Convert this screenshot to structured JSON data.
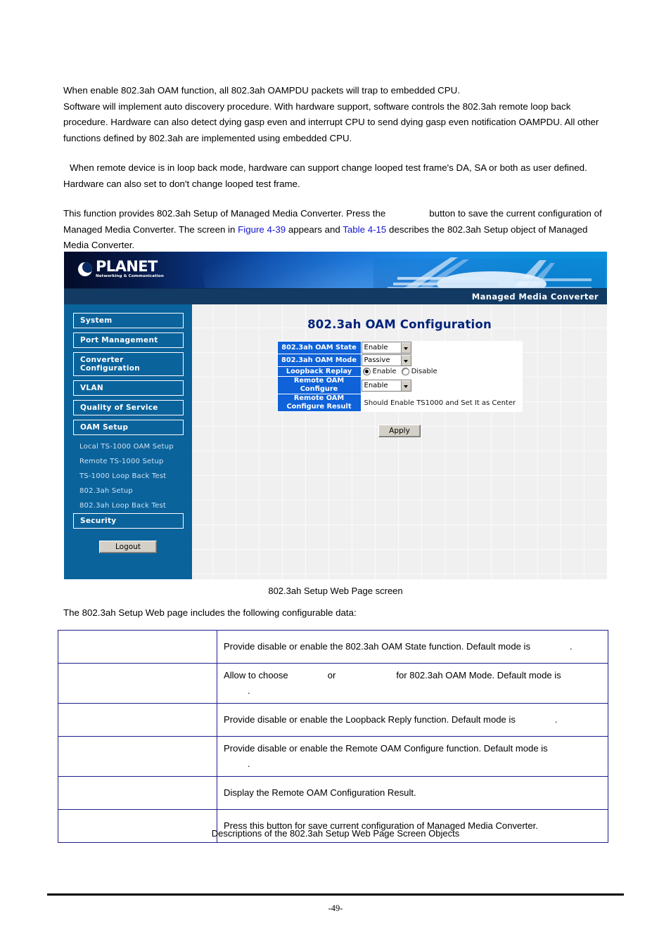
{
  "document": {
    "paragraphs": {
      "p1_line1": "When enable 802.3ah OAM function, all 802.3ah OAMPDU packets will trap to embedded CPU.",
      "p1_rest": "Software will implement auto discovery procedure. With hardware support, software controls the 802.3ah remote loop back procedure. Hardware can also detect dying gasp even and interrupt CPU to send dying gasp even notification OAMPDU. All other functions defined by 802.3ah are implemented using embedded CPU.",
      "p2": "When remote device is in loop back mode, hardware can support change looped test frame's DA, SA or both as user defined. Hardware can also set to don't change looped test frame.",
      "p3_a": "This function provides 802.3ah Setup of Managed Media Converter. Press the",
      "p3_b": "button to save the current configuration of Managed Media Converter. The screen in",
      "p3_link1": "Figure 4-39",
      "p3_c": "appears and",
      "p3_link2": "Table 4-15",
      "p3_d": "describes the 802.3ah Setup object of Managed Media Converter."
    },
    "figure_caption": "802.3ah Setup Web Page screen",
    "lead_in": "The 802.3ah Setup Web page includes the following configurable data:",
    "table_caption": "Descriptions of the 802.3ah Setup Web Page Screen Objects",
    "page_number": "-49-"
  },
  "figure": {
    "banner": {
      "logo_name": "PLANET",
      "logo_tagline": "Networking & Communication",
      "product_title": "Managed Media Converter"
    },
    "sidebar": {
      "menu": [
        {
          "label": "System",
          "type": "main"
        },
        {
          "label": "Port Management",
          "type": "main"
        },
        {
          "label": "Converter Configuration",
          "type": "main"
        },
        {
          "label": "VLAN",
          "type": "main"
        },
        {
          "label": "Quality of Service",
          "type": "main"
        },
        {
          "label": "OAM Setup",
          "type": "main"
        },
        {
          "label": "Local TS-1000 OAM Setup",
          "type": "sub"
        },
        {
          "label": "Remote TS-1000 Setup",
          "type": "sub"
        },
        {
          "label": "TS-1000 Loop Back Test",
          "type": "sub"
        },
        {
          "label": "802.3ah Setup",
          "type": "sub"
        },
        {
          "label": "802.3ah Loop Back Test",
          "type": "sub"
        },
        {
          "label": "Security",
          "type": "main"
        }
      ],
      "logout_label": "Logout"
    },
    "main": {
      "title": "802.3ah OAM Configuration",
      "rows": {
        "oam_state": {
          "label": "802.3ah OAM State",
          "control": "select",
          "value": "Enable"
        },
        "oam_mode": {
          "label": "802.3ah OAM Mode",
          "control": "select",
          "value": "Passive"
        },
        "loopback_replay": {
          "label": "Loopback Replay",
          "control": "radio",
          "options": [
            "Enable",
            "Disable"
          ],
          "selected": "Enable"
        },
        "remote_oam_configure": {
          "label": "Remote OAM Configure",
          "label_line1": "Remote OAM",
          "label_line2": "Configure",
          "control": "select",
          "value": "Enable"
        },
        "remote_oam_configure_result": {
          "label": "Remote OAM Configure Result",
          "label_line1": "Remote OAM",
          "label_line2": "Configure Result",
          "control": "text",
          "value": "Should Enable TS1000 and Set It as Center"
        }
      },
      "apply_label": "Apply"
    },
    "colors": {
      "sidebar_blue": "#0b639c",
      "label_blue": "#0f62d8",
      "title_navy": "#00237a",
      "subbar_navy": "#123a63"
    }
  },
  "desc_table": {
    "rows": [
      {
        "object": "",
        "desc_a": "Provide disable or enable the 802.3ah OAM State function. Default mode is",
        "desc_b": "."
      },
      {
        "object": "",
        "desc_a": "Allow to choose",
        "desc_mid": "or",
        "desc_b": "for 802.3ah OAM Mode. Default mode is",
        "desc_c": "."
      },
      {
        "object": "",
        "desc_a": "Provide disable or enable the Loopback Reply function. Default mode is",
        "desc_b": "."
      },
      {
        "object": "",
        "desc_a": "Provide disable or enable the Remote OAM Configure function. Default  mode is",
        "desc_b": "."
      },
      {
        "object": "",
        "desc_a": "Display the Remote OAM Configuration Result.",
        "desc_b": ""
      },
      {
        "object": "",
        "desc_a": "Press this button for save current configuration of Managed Media Converter.",
        "desc_b": ""
      }
    ]
  }
}
